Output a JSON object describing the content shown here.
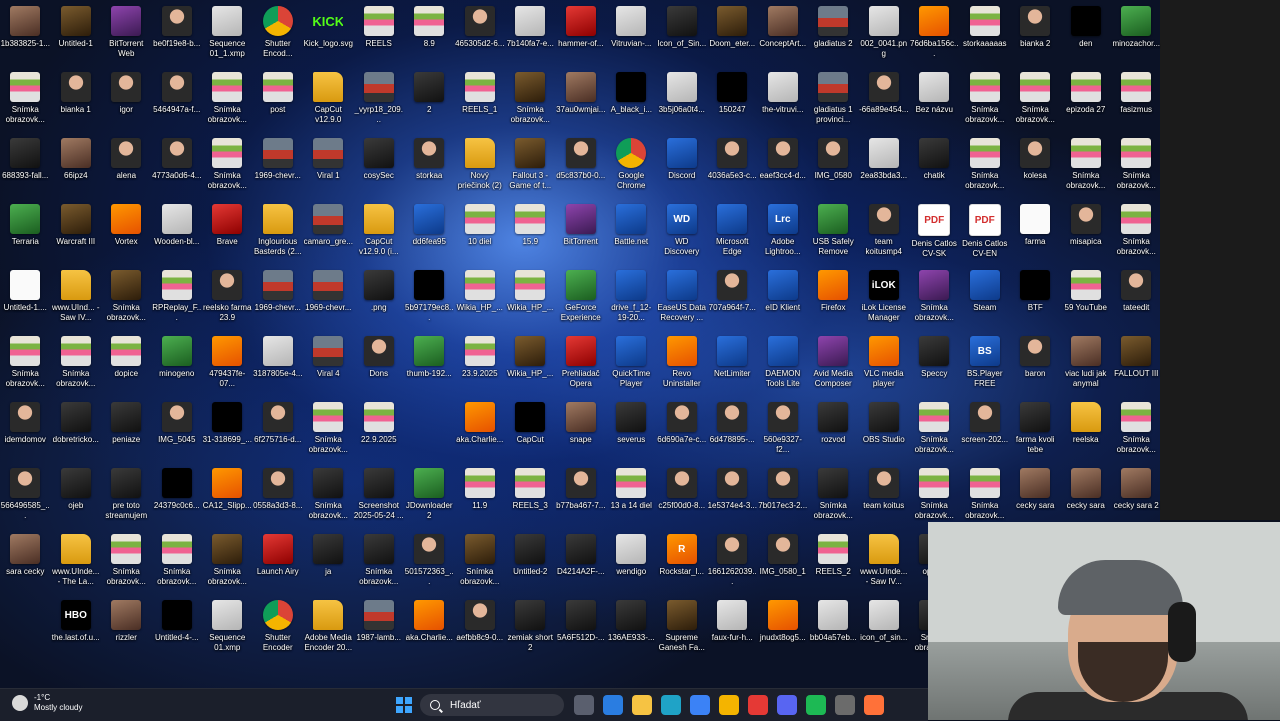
{
  "desktop_icons": [
    {
      "label": "1b383825-1...",
      "kind": "photo"
    },
    {
      "label": "Untitled-1",
      "kind": "game"
    },
    {
      "label": "BitTorrent Web",
      "kind": "purple"
    },
    {
      "label": "be0f19e8-b...",
      "kind": "person"
    },
    {
      "label": "Sequence 01_1.xmp",
      "kind": "light"
    },
    {
      "label": "Shutter Encod...",
      "kind": "chrome"
    },
    {
      "label": "Kick_logo.svg",
      "kind": "kick",
      "glyph": "KICK"
    },
    {
      "label": "REELS",
      "kind": "snim"
    },
    {
      "label": "8.9",
      "kind": "snim"
    },
    {
      "label": "465305d2-6...",
      "kind": "person"
    },
    {
      "label": "7b140fa7-e...",
      "kind": "light"
    },
    {
      "label": "hammer-of...",
      "kind": "red"
    },
    {
      "label": "Vitruvian-...",
      "kind": "light"
    },
    {
      "label": "Icon_of_Sin...",
      "kind": "dark"
    },
    {
      "label": "Doom_eter...",
      "kind": "game"
    },
    {
      "label": "ConceptArt...",
      "kind": "photo"
    },
    {
      "label": "gladiatus 2",
      "kind": "car"
    },
    {
      "label": "002_0041.png",
      "kind": "light"
    },
    {
      "label": "76d6ba156c...",
      "kind": "orange"
    },
    {
      "label": "storkaaaaas",
      "kind": "snim"
    },
    {
      "label": "bianka 2",
      "kind": "person"
    },
    {
      "label": "den",
      "kind": "black"
    },
    {
      "label": "minozachor...",
      "kind": "green"
    },
    {
      "label": "Snímka obrazovk...",
      "kind": "snim"
    },
    {
      "label": "bianka 1",
      "kind": "person"
    },
    {
      "label": "igor",
      "kind": "person"
    },
    {
      "label": "5464947a-f...",
      "kind": "person"
    },
    {
      "label": "Snímka obrazovk...",
      "kind": "snim"
    },
    {
      "label": "post",
      "kind": "snim"
    },
    {
      "label": "CapCut v12.9.0",
      "kind": "folder"
    },
    {
      "label": "_vyrp18_209...",
      "kind": "car"
    },
    {
      "label": "2",
      "kind": "dark"
    },
    {
      "label": "REELS_1",
      "kind": "snim"
    },
    {
      "label": "Snímka obrazovk...",
      "kind": "game"
    },
    {
      "label": "37au0wmjai...",
      "kind": "photo"
    },
    {
      "label": "A_black_i...",
      "kind": "black"
    },
    {
      "label": "3b5j06a0t4...",
      "kind": "light"
    },
    {
      "label": "150247",
      "kind": "black"
    },
    {
      "label": "the-vitruvi...",
      "kind": "light"
    },
    {
      "label": "gladiatus 1 provinci...",
      "kind": "car"
    },
    {
      "label": "-66a89e454...",
      "kind": "person"
    },
    {
      "label": "Bez názvu",
      "kind": "light"
    },
    {
      "label": "Snímka obrazovk...",
      "kind": "snim"
    },
    {
      "label": "Snímka obrazovk...",
      "kind": "snim"
    },
    {
      "label": "epizoda 27",
      "kind": "snim"
    },
    {
      "label": "fasizmus",
      "kind": "snim"
    },
    {
      "label": "688393-fall...",
      "kind": "dark"
    },
    {
      "label": "66ipz4",
      "kind": "photo"
    },
    {
      "label": "alena",
      "kind": "person"
    },
    {
      "label": "4773a0d6-4...",
      "kind": "person"
    },
    {
      "label": "Snímka obrazovk...",
      "kind": "snim"
    },
    {
      "label": "1969-chevr...",
      "kind": "car"
    },
    {
      "label": "Viral 1",
      "kind": "car"
    },
    {
      "label": "cosySec",
      "kind": "dark"
    },
    {
      "label": "storkaa",
      "kind": "person"
    },
    {
      "label": "Nový priečinok (2)",
      "kind": "folder"
    },
    {
      "label": "Fallout 3 - Game of t...",
      "kind": "game"
    },
    {
      "label": "d5c837b0-0...",
      "kind": "person"
    },
    {
      "label": "Google Chrome",
      "kind": "chrome"
    },
    {
      "label": "Discord",
      "kind": "app"
    },
    {
      "label": "4036a5e3-c...",
      "kind": "person"
    },
    {
      "label": "eaef3cc4-d...",
      "kind": "person"
    },
    {
      "label": "IMG_0580",
      "kind": "person"
    },
    {
      "label": "2ea83bda3...",
      "kind": "light"
    },
    {
      "label": "chatik",
      "kind": "dark"
    },
    {
      "label": "Snímka obrazovk...",
      "kind": "snim"
    },
    {
      "label": "kolesa",
      "kind": "person"
    },
    {
      "label": "Snímka obrazovk...",
      "kind": "snim"
    },
    {
      "label": "Snímka obrazovk...",
      "kind": "snim"
    },
    {
      "label": "Terraria",
      "kind": "green"
    },
    {
      "label": "Warcraft III",
      "kind": "game"
    },
    {
      "label": "Vortex",
      "kind": "orange"
    },
    {
      "label": "Wooden-bl...",
      "kind": "light"
    },
    {
      "label": "Brave",
      "kind": "red"
    },
    {
      "label": "Inglourious Basterds (2...",
      "kind": "folder"
    },
    {
      "label": "camaro_gre...",
      "kind": "car"
    },
    {
      "label": "CapCut v12.9.0 (i...",
      "kind": "folder"
    },
    {
      "label": "dd6fea95",
      "kind": "app"
    },
    {
      "label": "10 diel",
      "kind": "snim"
    },
    {
      "label": "15.9",
      "kind": "snim"
    },
    {
      "label": "BitTorrent",
      "kind": "purple"
    },
    {
      "label": "Battle.net",
      "kind": "app"
    },
    {
      "label": "WD Discovery",
      "kind": "app",
      "glyph": "WD"
    },
    {
      "label": "Microsoft Edge",
      "kind": "app"
    },
    {
      "label": "Adobe Lightroo...",
      "kind": "app",
      "glyph": "Lrc"
    },
    {
      "label": "USB Safely Remove",
      "kind": "green"
    },
    {
      "label": "team koitusmp4",
      "kind": "person"
    },
    {
      "label": "Denis Catlos CV-SK",
      "kind": "pdf",
      "glyph": "PDF"
    },
    {
      "label": "Denis Catlos CV-EN",
      "kind": "pdf",
      "glyph": "PDF"
    },
    {
      "label": "farma",
      "kind": "file"
    },
    {
      "label": "misapica",
      "kind": "person"
    },
    {
      "label": "Snímka obrazovk...",
      "kind": "snim"
    },
    {
      "label": "Untitled-1....",
      "kind": "file"
    },
    {
      "label": "www.UInd... - Saw IV...",
      "kind": "folder"
    },
    {
      "label": "Snímka obrazovk...",
      "kind": "game"
    },
    {
      "label": "RPReplay_F...",
      "kind": "snim"
    },
    {
      "label": "reelsko farma 23.9",
      "kind": "person"
    },
    {
      "label": "1969-chevr...",
      "kind": "car"
    },
    {
      "label": "1969-chevr...",
      "kind": "car"
    },
    {
      "label": ".png",
      "kind": "dark"
    },
    {
      "label": "5b97179ec8...",
      "kind": "black"
    },
    {
      "label": "Wikia_HP_...",
      "kind": "snim"
    },
    {
      "label": "Wikia_HP_...",
      "kind": "snim"
    },
    {
      "label": "GeForce Experience",
      "kind": "green"
    },
    {
      "label": "drive_f_12-19-20...",
      "kind": "app"
    },
    {
      "label": "EaseUS Data Recovery ...",
      "kind": "app"
    },
    {
      "label": "707a964f-7...",
      "kind": "person"
    },
    {
      "label": "eID Klient",
      "kind": "app"
    },
    {
      "label": "Firefox",
      "kind": "orange"
    },
    {
      "label": "iLok License Manager",
      "kind": "black",
      "glyph": "iLOK"
    },
    {
      "label": "Snímka obrazovk...",
      "kind": "purple"
    },
    {
      "label": "Steam",
      "kind": "app"
    },
    {
      "label": "BTF",
      "kind": "black"
    },
    {
      "label": "59 YouTube",
      "kind": "snim"
    },
    {
      "label": "tateedit",
      "kind": "person"
    },
    {
      "label": "Snímka obrazovk...",
      "kind": "snim"
    },
    {
      "label": "Snímka obrazovk...",
      "kind": "snim"
    },
    {
      "label": "dopice",
      "kind": "snim"
    },
    {
      "label": "minogeno",
      "kind": "green"
    },
    {
      "label": "479437fe-07...",
      "kind": "orange"
    },
    {
      "label": "3187805e-4...",
      "kind": "light"
    },
    {
      "label": "Viral 4",
      "kind": "car"
    },
    {
      "label": "Dons",
      "kind": "person"
    },
    {
      "label": "thumb-192...",
      "kind": "green"
    },
    {
      "label": "23.9.2025",
      "kind": "snim"
    },
    {
      "label": "Wikia_HP_...",
      "kind": "game"
    },
    {
      "label": "Prehliadač Opera",
      "kind": "red"
    },
    {
      "label": "QuickTime Player",
      "kind": "app"
    },
    {
      "label": "Revo Uninstaller",
      "kind": "orange"
    },
    {
      "label": "NetLimiter",
      "kind": "app"
    },
    {
      "label": "DAEMON Tools Lite",
      "kind": "app"
    },
    {
      "label": "Avid Media Composer",
      "kind": "purple"
    },
    {
      "label": "VLC media player",
      "kind": "orange"
    },
    {
      "label": "Speccy",
      "kind": "dark"
    },
    {
      "label": "BS.Player FREE",
      "kind": "app",
      "glyph": "BS"
    },
    {
      "label": "baron",
      "kind": "person"
    },
    {
      "label": "viac ludi jak anymal",
      "kind": "photo"
    },
    {
      "label": "FALLOUT III",
      "kind": "game"
    },
    {
      "label": "idemdomov",
      "kind": "person"
    },
    {
      "label": "dobretricko...",
      "kind": "dark"
    },
    {
      "label": "peniaze",
      "kind": "dark"
    },
    {
      "label": "IMG_5045",
      "kind": "person"
    },
    {
      "label": "31-318699_...",
      "kind": "black"
    },
    {
      "label": "6f275716-d...",
      "kind": "person"
    },
    {
      "label": "Snímka obrazovk...",
      "kind": "snim"
    },
    {
      "label": "22.9.2025",
      "kind": "snim"
    },
    {
      "label": "",
      "kind": "none"
    },
    {
      "label": "aka.Charlie...",
      "kind": "orange"
    },
    {
      "label": "CapCut",
      "kind": "black"
    },
    {
      "label": "snape",
      "kind": "photo"
    },
    {
      "label": "severus",
      "kind": "dark"
    },
    {
      "label": "6d690a7e-c...",
      "kind": "person"
    },
    {
      "label": "6d478895-...",
      "kind": "person"
    },
    {
      "label": "560e9327-f2...",
      "kind": "person"
    },
    {
      "label": "rozvod",
      "kind": "dark"
    },
    {
      "label": "OBS Studio",
      "kind": "dark"
    },
    {
      "label": "Snímka obrazovk...",
      "kind": "snim"
    },
    {
      "label": "screen-202...",
      "kind": "person"
    },
    {
      "label": "farma kvoli tebe",
      "kind": "dark"
    },
    {
      "label": "reelska",
      "kind": "folder"
    },
    {
      "label": "Snímka obrazovk...",
      "kind": "snim"
    },
    {
      "label": "566496585_...",
      "kind": "person"
    },
    {
      "label": "ojeb",
      "kind": "dark"
    },
    {
      "label": "pre toto streamujem",
      "kind": "dark"
    },
    {
      "label": "24379c0c6...",
      "kind": "black"
    },
    {
      "label": "CA12_Slipp...",
      "kind": "orange"
    },
    {
      "label": "0558a3d3-8...",
      "kind": "person"
    },
    {
      "label": "Snímka obrazovk...",
      "kind": "dark"
    },
    {
      "label": "Screenshot 2025-05-24 ...",
      "kind": "dark"
    },
    {
      "label": "JDownloader 2",
      "kind": "green"
    },
    {
      "label": "11.9",
      "kind": "snim"
    },
    {
      "label": "REELS_3",
      "kind": "snim"
    },
    {
      "label": "b77ba467-7...",
      "kind": "person"
    },
    {
      "label": "13 a 14 diel",
      "kind": "snim"
    },
    {
      "label": "c25f00d0-8...",
      "kind": "person"
    },
    {
      "label": "1e5374e4-3...",
      "kind": "person"
    },
    {
      "label": "7b017ec3-2...",
      "kind": "person"
    },
    {
      "label": "Snímka obrazovk...",
      "kind": "dark"
    },
    {
      "label": "team koitus",
      "kind": "person"
    },
    {
      "label": "Snímka obrazovk...",
      "kind": "snim"
    },
    {
      "label": "Snímka obrazovk...",
      "kind": "snim"
    },
    {
      "label": "cecky sara",
      "kind": "photo"
    },
    {
      "label": "cecky sara",
      "kind": "photo"
    },
    {
      "label": "cecky sara 2",
      "kind": "photo"
    },
    {
      "label": "sara cecky",
      "kind": "photo"
    },
    {
      "label": "www.UInde... - The La...",
      "kind": "folder"
    },
    {
      "label": "Snímka obrazovk...",
      "kind": "snim"
    },
    {
      "label": "Snímka obrazovk...",
      "kind": "snim"
    },
    {
      "label": "Snímka obrazovk...",
      "kind": "game"
    },
    {
      "label": "Launch Airy",
      "kind": "red"
    },
    {
      "label": "ja",
      "kind": "dark"
    },
    {
      "label": "Snímka obrazovk...",
      "kind": "dark"
    },
    {
      "label": "501572363_...",
      "kind": "person"
    },
    {
      "label": "Snímka obrazovk...",
      "kind": "game"
    },
    {
      "label": "Untitled-2",
      "kind": "dark"
    },
    {
      "label": "D4214A2F-...",
      "kind": "dark"
    },
    {
      "label": "wendigo",
      "kind": "light"
    },
    {
      "label": "Rockstar_l...",
      "kind": "orange",
      "glyph": "R"
    },
    {
      "label": "1661262039...",
      "kind": "person"
    },
    {
      "label": "IMG_0580_1",
      "kind": "person"
    },
    {
      "label": "REELS_2",
      "kind": "snim"
    },
    {
      "label": "www.UInde... - Saw IV...",
      "kind": "folder"
    },
    {
      "label": "oplutie",
      "kind": "dark"
    },
    {
      "label": "RPR",
      "kind": "snim"
    },
    {
      "label": "",
      "kind": "none"
    },
    {
      "label": "",
      "kind": "none"
    },
    {
      "label": "",
      "kind": "none"
    },
    {
      "label": "",
      "kind": "none"
    },
    {
      "label": "the.last.of.u...",
      "kind": "black",
      "glyph": "HBO"
    },
    {
      "label": "rizzler",
      "kind": "photo"
    },
    {
      "label": "Untitled-4-...",
      "kind": "black"
    },
    {
      "label": "Sequence 01.xmp",
      "kind": "light"
    },
    {
      "label": "Shutter Encoder",
      "kind": "chrome"
    },
    {
      "label": "Adobe Media Encoder 20...",
      "kind": "folder"
    },
    {
      "label": "1987-lamb...",
      "kind": "car"
    },
    {
      "label": "aka.Charlie...",
      "kind": "orange"
    },
    {
      "label": "aefbb8c9-0...",
      "kind": "person"
    },
    {
      "label": "zemiak short 2",
      "kind": "dark"
    },
    {
      "label": "5A6F512D-...",
      "kind": "dark"
    },
    {
      "label": "136AE933-...",
      "kind": "dark"
    },
    {
      "label": "Supreme Ganesh Fa...",
      "kind": "game"
    },
    {
      "label": "faux-fur-h...",
      "kind": "light"
    },
    {
      "label": "jnudxt8og5...",
      "kind": "orange"
    },
    {
      "label": "bb04a57eb...",
      "kind": "light"
    },
    {
      "label": "icon_of_sin...",
      "kind": "light"
    },
    {
      "label": "Snímka obrazovk...",
      "kind": "dark"
    },
    {
      "label": "ob",
      "kind": "dark"
    }
  ],
  "taskbar": {
    "weather": {
      "temp": "-1°C",
      "condition": "Mostly cloudy"
    },
    "search_placeholder": "Hľadať",
    "apps": [
      {
        "name": "task-view-icon",
        "color": "#5a5f6e"
      },
      {
        "name": "store-icon",
        "color": "#2a7de1"
      },
      {
        "name": "file-explorer-icon",
        "color": "#f6c343"
      },
      {
        "name": "edge-icon",
        "color": "#1fa3c7"
      },
      {
        "name": "photos-icon",
        "color": "#3b82f6"
      },
      {
        "name": "chrome-icon",
        "color": "#f4b400"
      },
      {
        "name": "brave-icon",
        "color": "#e53935"
      },
      {
        "name": "discord-icon",
        "color": "#5865f2"
      },
      {
        "name": "spotify-icon",
        "color": "#1db954"
      },
      {
        "name": "obs-icon",
        "color": "#6b6b6b"
      },
      {
        "name": "firefox-icon",
        "color": "#ff7139"
      }
    ]
  }
}
